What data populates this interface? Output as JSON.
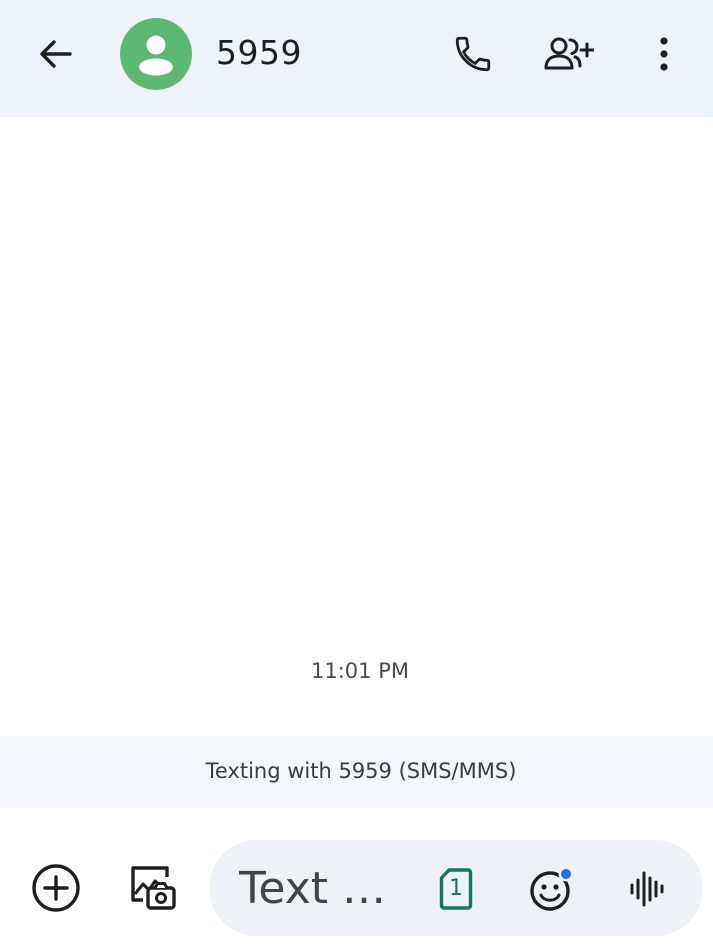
{
  "header": {
    "contact_name": "5959",
    "avatar_color": "#5bb974",
    "icons": {
      "back": "arrow-back-icon",
      "call": "phone-icon",
      "add_contact": "person-add-icon",
      "more": "more-vert-icon"
    }
  },
  "conversation": {
    "timestamp": "11:01 PM",
    "info": "Texting with 5959 (SMS/MMS)"
  },
  "composer": {
    "placeholder": "Text …",
    "sim_number": "1",
    "sim_color": "#0b7a5e",
    "emoji_badge_color": "#1a73e8",
    "icons": {
      "attach": "add-circle-icon",
      "gallery": "gallery-camera-icon",
      "sim": "sim-card-icon",
      "emoji": "emoji-icon",
      "voice": "voice-wave-icon"
    }
  }
}
